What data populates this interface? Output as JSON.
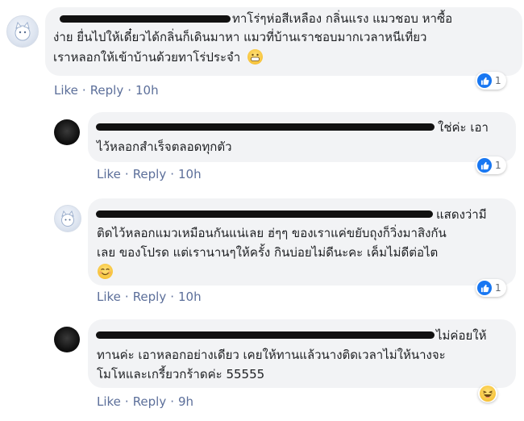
{
  "comments": [
    {
      "text_lines": [
        "ทาโร่ๆห่อสีเหลือง กลิ่นแรง แมวชอบ หาซื้อ",
        "ง่าย ยื่นไปให้เดี๋ยวได้กลิ่นก็เดินมาหา แมวที่บ้านเราชอบมากเวลาหนีเที่ยว",
        "เราหลอกให้เข้าบ้านด้วยทาโร่ประจำ"
      ],
      "emoji": "grinning-face",
      "actions": {
        "like": "Like",
        "reply": "Reply",
        "time": "10h"
      },
      "reaction": {
        "type": "like-icon",
        "count": "1"
      }
    },
    {
      "text_lines": [
        "ใช่ค่ะ เอา",
        "ไว้หลอกสำเร็จตลอดทุกตัว"
      ],
      "actions": {
        "like": "Like",
        "reply": "Reply",
        "time": "10h"
      },
      "reaction": {
        "type": "like-icon",
        "count": "1"
      }
    },
    {
      "text_lines": [
        "แสดงว่ามี",
        "ติดไว้หลอกแมวเหมือนกันแน่เลย ฮ่ๆๆ ของเราแค่ขยับถุงก็วิ่งมาสิงกัน",
        "เลย ของโปรด แต่เรานานๆให้ครั้ง กินบ่อยไม่ดีนะคะ เค็มไม่ดีต่อไต"
      ],
      "emoji": "smiling-face",
      "actions": {
        "like": "Like",
        "reply": "Reply",
        "time": "10h"
      },
      "reaction": {
        "type": "like-icon",
        "count": "1"
      }
    },
    {
      "text_lines": [
        "ไม่ค่อยให้",
        "ทานค่ะ เอาหลอกอย่างเดียว เคยให้ทานแล้วนางติดเวลาไม่ให้นางจะ",
        "โมโหและเกรี้ยวกร้าดค่ะ 55555"
      ],
      "actions": {
        "like": "Like",
        "reply": "Reply",
        "time": "9h"
      },
      "reaction": {
        "type": "haha-icon",
        "count": ""
      }
    }
  ],
  "colors": {
    "bubble": "#f2f3f5",
    "link": "#5c6f9a",
    "like_blue": "#1877f2",
    "text": "#1c1e21"
  }
}
